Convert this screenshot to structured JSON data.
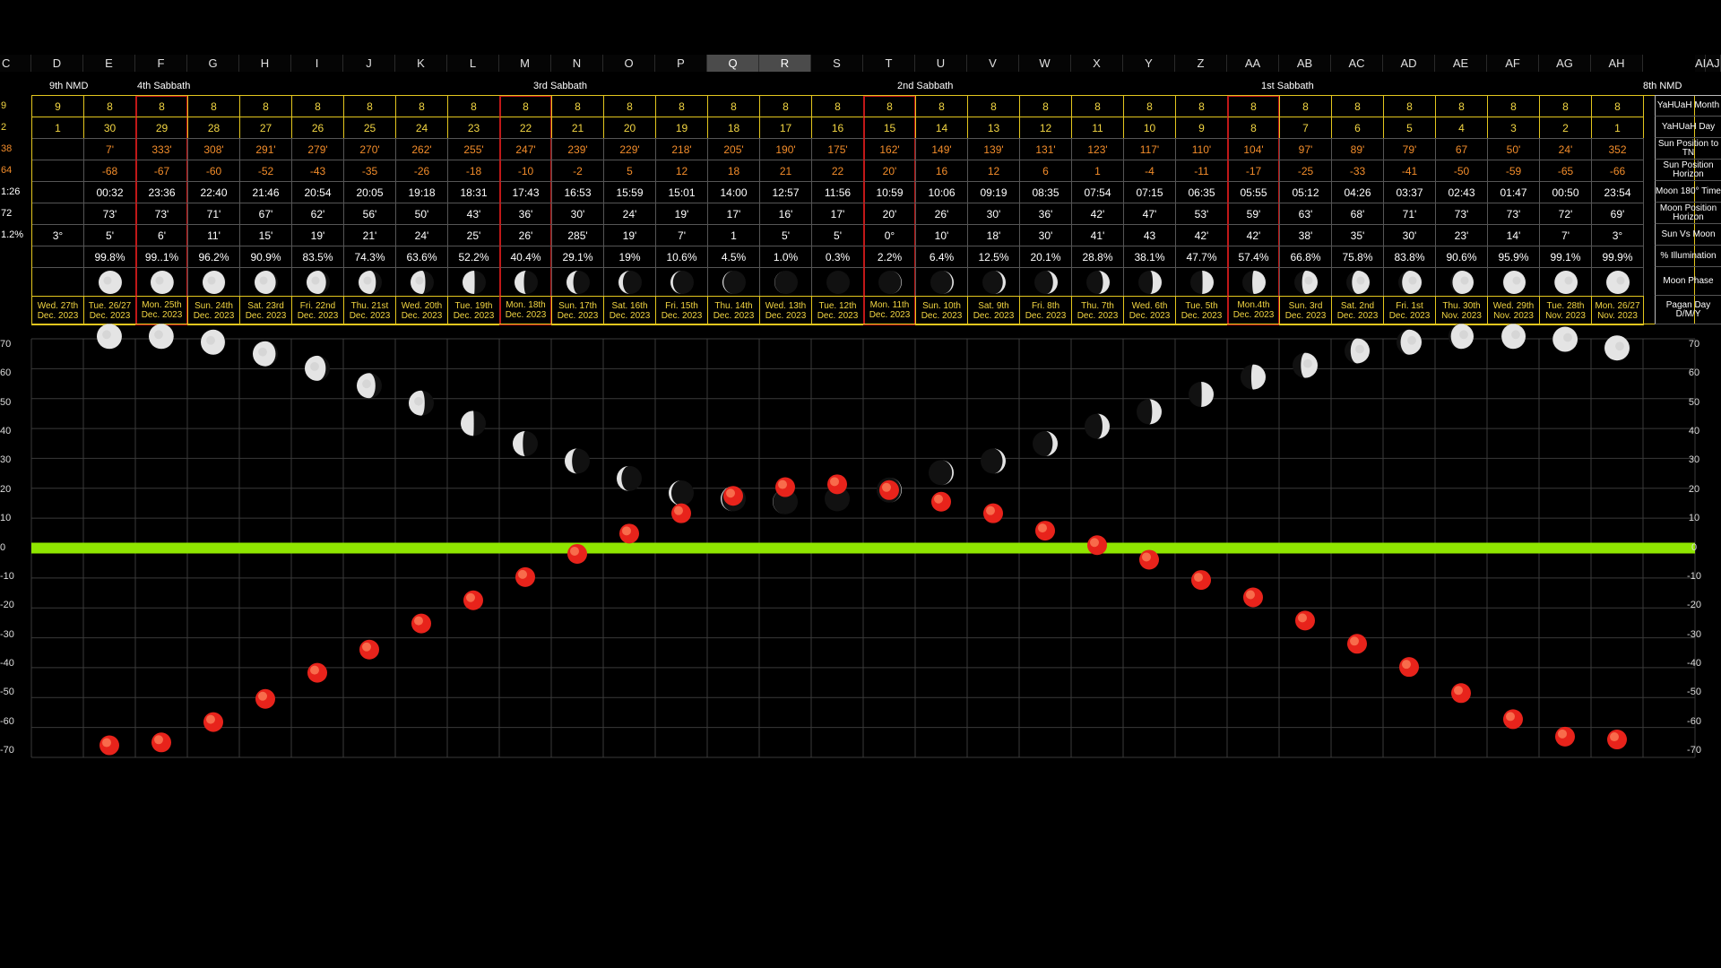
{
  "spreadsheet": {
    "column_letters": [
      "C",
      "D",
      "E",
      "F",
      "G",
      "H",
      "I",
      "J",
      "K",
      "L",
      "M",
      "N",
      "O",
      "P",
      "Q",
      "R",
      "S",
      "T",
      "U",
      "V",
      "W",
      "X",
      "Y",
      "Z",
      "AA",
      "AB",
      "AC",
      "AD",
      "AE",
      "AF",
      "AG",
      "AH",
      "AI",
      "AJ"
    ],
    "selected_columns": [
      "Q",
      "R"
    ],
    "left_labels_top": [
      "9th NMD",
      "4th Sabbath"
    ],
    "sabbath_labels": [
      {
        "text": "9th NMD",
        "col": 1
      },
      {
        "text": "4th Sabbath",
        "col": 3
      },
      {
        "text": "3rd Sabbath",
        "col": 10
      },
      {
        "text": "2nd Sabbath",
        "col": 17
      },
      {
        "text": "1st Sabbath",
        "col": 24
      },
      {
        "text": "8th NMD",
        "col": 31
      }
    ],
    "row_labels": [
      "YaHUaH Month",
      "YaHUaH Day",
      "Sun Position to TN",
      "Sun Position Horizon",
      "Moon 180° Time",
      "Moon Position Horizon",
      "Sun Vs Moon",
      "% Illumination",
      "Moon Phase",
      "Pagan Day D/M/Y"
    ],
    "left_stub": [
      "9",
      "2",
      "38",
      "64",
      "1:26",
      "72",
      "1.2%",
      "",
      "",
      ""
    ],
    "highlight_columns": [
      "F",
      "M",
      "T",
      "AA"
    ],
    "columns": [
      {
        "col": "D",
        "month": "9",
        "day": "1",
        "sun_tn": "",
        "sun_h": "",
        "moon_time": "",
        "moon_h": "",
        "svm": "3°",
        "illum": "",
        "phase": "",
        "date1": "Wed. 27th",
        "date2": "Dec. 2023"
      },
      {
        "col": "E",
        "month": "8",
        "day": "30",
        "sun_tn": "7'",
        "sun_h": "-68",
        "moon_time": "00:32",
        "moon_h": "73'",
        "svm": "5'",
        "illum": "99.8%",
        "phase": 0.998,
        "date1": "Tue. 26/27",
        "date2": "Dec. 2023"
      },
      {
        "col": "F",
        "month": "8",
        "day": "29",
        "sun_tn": "333'",
        "sun_h": "-67",
        "moon_time": "23:36",
        "moon_h": "73'",
        "svm": "6'",
        "illum": "99..1%",
        "phase": 0.991,
        "date1": "Mon. 25th",
        "date2": "Dec. 2023"
      },
      {
        "col": "G",
        "month": "8",
        "day": "28",
        "sun_tn": "308'",
        "sun_h": "-60",
        "moon_time": "22:40",
        "moon_h": "71'",
        "svm": "11'",
        "illum": "96.2%",
        "phase": 0.962,
        "date1": "Sun. 24th",
        "date2": "Dec. 2023"
      },
      {
        "col": "H",
        "month": "8",
        "day": "27",
        "sun_tn": "291'",
        "sun_h": "-52",
        "moon_time": "21:46",
        "moon_h": "67'",
        "svm": "15'",
        "illum": "90.9%",
        "phase": 0.909,
        "date1": "Sat. 23rd",
        "date2": "Dec. 2023"
      },
      {
        "col": "I",
        "month": "8",
        "day": "26",
        "sun_tn": "279'",
        "sun_h": "-43",
        "moon_time": "20:54",
        "moon_h": "62'",
        "svm": "19'",
        "illum": "83.5%",
        "phase": 0.835,
        "date1": "Fri. 22nd",
        "date2": "Dec. 2023"
      },
      {
        "col": "J",
        "month": "8",
        "day": "25",
        "sun_tn": "270'",
        "sun_h": "-35",
        "moon_time": "20:05",
        "moon_h": "56'",
        "svm": "21'",
        "illum": "74.3%",
        "phase": 0.743,
        "date1": "Thu. 21st",
        "date2": "Dec. 2023"
      },
      {
        "col": "K",
        "month": "8",
        "day": "24",
        "sun_tn": "262'",
        "sun_h": "-26",
        "moon_time": "19:18",
        "moon_h": "50'",
        "svm": "24'",
        "illum": "63.6%",
        "phase": 0.636,
        "date1": "Wed. 20th",
        "date2": "Dec. 2023"
      },
      {
        "col": "L",
        "month": "8",
        "day": "23",
        "sun_tn": "255'",
        "sun_h": "-18",
        "moon_time": "18:31",
        "moon_h": "43'",
        "svm": "25'",
        "illum": "52.2%",
        "phase": 0.522,
        "date1": "Tue. 19th",
        "date2": "Dec. 2023"
      },
      {
        "col": "M",
        "month": "8",
        "day": "22",
        "sun_tn": "247'",
        "sun_h": "-10",
        "moon_time": "17:43",
        "moon_h": "36'",
        "svm": "26'",
        "illum": "40.4%",
        "phase": 0.404,
        "date1": "Mon. 18th",
        "date2": "Dec. 2023"
      },
      {
        "col": "N",
        "month": "8",
        "day": "21",
        "sun_tn": "239'",
        "sun_h": "-2",
        "moon_time": "16:53",
        "moon_h": "30'",
        "svm": "285'",
        "illum": "29.1%",
        "phase": 0.291,
        "date1": "Sun. 17th",
        "date2": "Dec. 2023"
      },
      {
        "col": "O",
        "month": "8",
        "day": "20",
        "sun_tn": "229'",
        "sun_h": "5",
        "moon_time": "15:59",
        "moon_h": "24'",
        "svm": "19'",
        "illum": "19%",
        "phase": 0.19,
        "date1": "Sat. 16th",
        "date2": "Dec. 2023"
      },
      {
        "col": "P",
        "month": "8",
        "day": "19",
        "sun_tn": "218'",
        "sun_h": "12",
        "moon_time": "15:01",
        "moon_h": "19'",
        "svm": "7'",
        "illum": "10.6%",
        "phase": 0.106,
        "date1": "Fri. 15th",
        "date2": "Dec. 2023"
      },
      {
        "col": "Q",
        "month": "8",
        "day": "18",
        "sun_tn": "205'",
        "sun_h": "18",
        "moon_time": "14:00",
        "moon_h": "17'",
        "svm": "1",
        "illum": "4.5%",
        "phase": 0.045,
        "date1": "Thu. 14th",
        "date2": "Dec. 2023"
      },
      {
        "col": "R",
        "month": "8",
        "day": "17",
        "sun_tn": "190'",
        "sun_h": "21",
        "moon_time": "12:57",
        "moon_h": "16'",
        "svm": "5'",
        "illum": "1.0%",
        "phase": 0.01,
        "date1": "Wed. 13th",
        "date2": "Dec. 2023"
      },
      {
        "col": "S",
        "month": "8",
        "day": "16",
        "sun_tn": "175'",
        "sun_h": "22",
        "moon_time": "11:56",
        "moon_h": "17'",
        "svm": "5'",
        "illum": "0.3%",
        "phase": 0.003,
        "date1": "Tue. 12th",
        "date2": "Dec. 2023"
      },
      {
        "col": "T",
        "month": "8",
        "day": "15",
        "sun_tn": "162'",
        "sun_h": "20'",
        "moon_time": "10:59",
        "moon_h": "20'",
        "svm": "0°",
        "illum": "2.2%",
        "phase": 0.022,
        "date1": "Mon. 11th",
        "date2": "Dec. 2023"
      },
      {
        "col": "U",
        "month": "8",
        "day": "14",
        "sun_tn": "149'",
        "sun_h": "16",
        "moon_time": "10:06",
        "moon_h": "26'",
        "svm": "10'",
        "illum": "6.4%",
        "phase": 0.064,
        "date1": "Sun. 10th",
        "date2": "Dec. 2023"
      },
      {
        "col": "V",
        "month": "8",
        "day": "13",
        "sun_tn": "139'",
        "sun_h": "12",
        "moon_time": "09:19",
        "moon_h": "30'",
        "svm": "18'",
        "illum": "12.5%",
        "phase": 0.125,
        "date1": "Sat. 9th",
        "date2": "Dec. 2023"
      },
      {
        "col": "W",
        "month": "8",
        "day": "12",
        "sun_tn": "131'",
        "sun_h": "6",
        "moon_time": "08:35",
        "moon_h": "36'",
        "svm": "30'",
        "illum": "20.1%",
        "phase": 0.201,
        "date1": "Fri. 8th",
        "date2": "Dec. 2023"
      },
      {
        "col": "X",
        "month": "8",
        "day": "11",
        "sun_tn": "123'",
        "sun_h": "1",
        "moon_time": "07:54",
        "moon_h": "42'",
        "svm": "41'",
        "illum": "28.8%",
        "phase": 0.288,
        "date1": "Thu. 7th",
        "date2": "Dec. 2023"
      },
      {
        "col": "Y",
        "month": "8",
        "day": "10",
        "sun_tn": "117'",
        "sun_h": "-4",
        "moon_time": "07:15",
        "moon_h": "47'",
        "svm": "43",
        "illum": "38.1%",
        "phase": 0.381,
        "date1": "Wed. 6th",
        "date2": "Dec. 2023"
      },
      {
        "col": "Z",
        "month": "8",
        "day": "9",
        "sun_tn": "110'",
        "sun_h": "-11",
        "moon_time": "06:35",
        "moon_h": "53'",
        "svm": "42'",
        "illum": "47.7%",
        "phase": 0.477,
        "date1": "Tue. 5th",
        "date2": "Dec. 2023"
      },
      {
        "col": "AA",
        "month": "8",
        "day": "8",
        "sun_tn": "104'",
        "sun_h": "-17",
        "moon_time": "05:55",
        "moon_h": "59'",
        "svm": "42'",
        "illum": "57.4%",
        "phase": 0.574,
        "date1": "Mon.4th",
        "date2": "Dec. 2023"
      },
      {
        "col": "AB",
        "month": "8",
        "day": "7",
        "sun_tn": "97'",
        "sun_h": "-25",
        "moon_time": "05:12",
        "moon_h": "63'",
        "svm": "38'",
        "illum": "66.8%",
        "phase": 0.668,
        "date1": "Sun. 3rd",
        "date2": "Dec. 2023"
      },
      {
        "col": "AC",
        "month": "8",
        "day": "6",
        "sun_tn": "89'",
        "sun_h": "-33",
        "moon_time": "04:26",
        "moon_h": "68'",
        "svm": "35'",
        "illum": "75.8%",
        "phase": 0.758,
        "date1": "Sat. 2nd",
        "date2": "Dec. 2023"
      },
      {
        "col": "AD",
        "month": "8",
        "day": "5",
        "sun_tn": "79'",
        "sun_h": "-41",
        "moon_time": "03:37",
        "moon_h": "71'",
        "svm": "30'",
        "illum": "83.8%",
        "phase": 0.838,
        "date1": "Fri. 1st",
        "date2": "Dec. 2023"
      },
      {
        "col": "AE",
        "month": "8",
        "day": "4",
        "sun_tn": "67",
        "sun_h": "-50",
        "moon_time": "02:43",
        "moon_h": "73'",
        "svm": "23'",
        "illum": "90.6%",
        "phase": 0.906,
        "date1": "Thu. 30th",
        "date2": "Nov. 2023"
      },
      {
        "col": "AF",
        "month": "8",
        "day": "3",
        "sun_tn": "50'",
        "sun_h": "-59",
        "moon_time": "01:47",
        "moon_h": "73'",
        "svm": "14'",
        "illum": "95.9%",
        "phase": 0.959,
        "date1": "Wed. 29th",
        "date2": "Nov. 2023"
      },
      {
        "col": "AG",
        "month": "8",
        "day": "2",
        "sun_tn": "24'",
        "sun_h": "-65",
        "moon_time": "00:50",
        "moon_h": "72'",
        "svm": "7'",
        "illum": "99.1%",
        "phase": 0.991,
        "date1": "Tue. 28th",
        "date2": "Nov. 2023"
      },
      {
        "col": "AH",
        "month": "8",
        "day": "1",
        "sun_tn": "352",
        "sun_h": "-66",
        "moon_time": "23:54",
        "moon_h": "69'",
        "svm": "3°",
        "illum": "99.9%",
        "phase": 0.999,
        "date1": "Mon. 26/27",
        "date2": "Nov. 2023"
      }
    ]
  },
  "chart_data": {
    "type": "scatter",
    "title": "",
    "xlabel": "",
    "ylabel": "",
    "ylim": [
      -70,
      70
    ],
    "y_ticks_left": [
      "70",
      "60",
      "50",
      "40",
      "30",
      "20",
      "10",
      "0",
      "-10",
      "-20",
      "-30",
      "-40",
      "-50",
      "-60",
      "-70"
    ],
    "y_ticks_right": [
      "70",
      "60",
      "50",
      "40",
      "30",
      "20",
      "10",
      "0",
      "-10",
      "-20",
      "-30",
      "-40",
      "-50",
      "-60",
      "-70"
    ],
    "horizon_line_value": 0,
    "horizon_color": "#8fe600",
    "categories": [
      "E",
      "F",
      "G",
      "H",
      "I",
      "J",
      "K",
      "L",
      "M",
      "N",
      "O",
      "P",
      "Q",
      "R",
      "S",
      "T",
      "U",
      "V",
      "W",
      "X",
      "Y",
      "Z",
      "AA",
      "AB",
      "AC",
      "AD",
      "AE",
      "AF",
      "AG",
      "AH"
    ],
    "series": [
      {
        "values": [
          73,
          73,
          71,
          67,
          62,
          56,
          50,
          43,
          36,
          30,
          24,
          19,
          17,
          16,
          17,
          20,
          26,
          30,
          36,
          42,
          47,
          53,
          59,
          63,
          68,
          71,
          73,
          73,
          72,
          69
        ]
      },
      {
        "values": [
          -68,
          -67,
          -60,
          -52,
          -43,
          -35,
          -26,
          -18,
          -10,
          -2,
          5,
          12,
          18,
          21,
          22,
          20,
          16,
          12,
          6,
          1,
          -4,
          -11,
          -17,
          -25,
          -33,
          -41,
          -50,
          -59,
          -65,
          -66
        ]
      }
    ],
    "moon_phase_fraction": [
      0.998,
      0.991,
      0.962,
      0.909,
      0.835,
      0.743,
      0.636,
      0.522,
      0.404,
      0.291,
      0.19,
      0.106,
      0.045,
      0.01,
      0.003,
      0.022,
      0.064,
      0.125,
      0.201,
      0.288,
      0.381,
      0.477,
      0.574,
      0.668,
      0.758,
      0.838,
      0.906,
      0.959,
      0.991,
      0.999
    ],
    "moon_waxing": [
      false,
      false,
      false,
      false,
      false,
      false,
      false,
      false,
      false,
      false,
      false,
      false,
      false,
      false,
      false,
      true,
      true,
      true,
      true,
      true,
      true,
      true,
      true,
      true,
      true,
      true,
      true,
      true,
      true,
      true
    ],
    "sun_color": "#e8231b",
    "moon_color": "#dcdcdc"
  }
}
